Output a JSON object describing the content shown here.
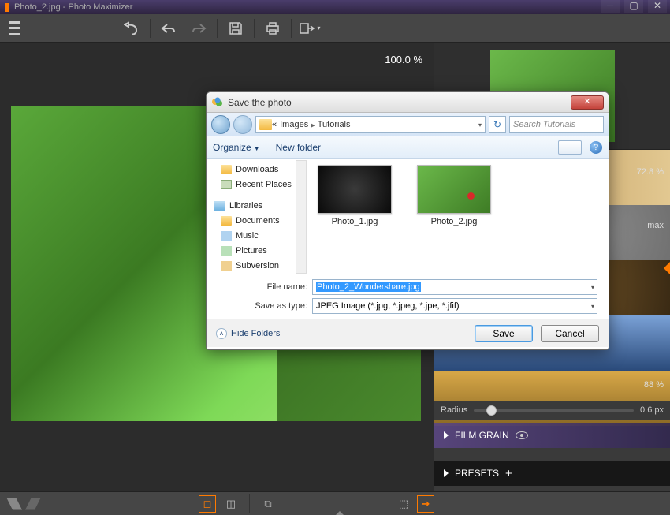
{
  "title": "Photo_2.jpg - Photo Maximizer",
  "zoom": "100.0 %",
  "right_panel": {
    "val1": "72.8 %",
    "val2": "max",
    "sharpen_pct": "88 %",
    "radius_label": "Radius",
    "radius_val": "0.6 px",
    "film_grain": "FILM GRAIN",
    "presets": "PRESETS"
  },
  "dialog": {
    "title": "Save the photo",
    "bc_prefix": "«",
    "bc1": "Images",
    "bc2": "Tutorials",
    "search_placeholder": "Search Tutorials",
    "organize": "Organize",
    "new_folder": "New folder",
    "help": "?",
    "tree": {
      "downloads": "Downloads",
      "recent": "Recent Places",
      "libraries": "Libraries",
      "documents": "Documents",
      "music": "Music",
      "pictures": "Pictures",
      "subversion": "Subversion"
    },
    "files": [
      {
        "name": "Photo_1.jpg"
      },
      {
        "name": "Photo_2.jpg"
      }
    ],
    "filename_label": "File name:",
    "filename_value": "Photo_2_Wondershare.jpg",
    "type_label": "Save as type:",
    "type_value": "JPEG Image (*.jpg, *.jpeg, *.jpe, *.jfif)",
    "hide_folders": "Hide Folders",
    "save": "Save",
    "cancel": "Cancel"
  }
}
